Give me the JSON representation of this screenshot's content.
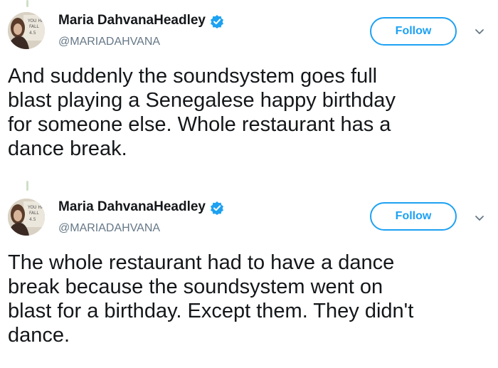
{
  "tweets": [
    {
      "display_name": "Maria DahvanaHeadley",
      "handle": "@MARIADAHVANA",
      "verified": true,
      "follow_label": "Follow",
      "text": "And suddenly the soundsystem goes full\nblast playing a Senegalese happy birthday\nfor someone else. Whole restaurant has a\ndance break."
    },
    {
      "display_name": "Maria DahvanaHeadley",
      "handle": "@MARIADAHVANA",
      "verified": true,
      "follow_label": "Follow",
      "text": "The whole restaurant had to have a dance\nbreak because the soundsystem went on\nblast for a birthday. Except them. They didn't\ndance."
    }
  ],
  "colors": {
    "accent": "#1da1f2",
    "handle": "#657786",
    "text": "#14171a",
    "thread_line": "#cfe0c8"
  },
  "icons": [
    "verified-badge-icon",
    "chevron-down-icon",
    "avatar"
  ]
}
